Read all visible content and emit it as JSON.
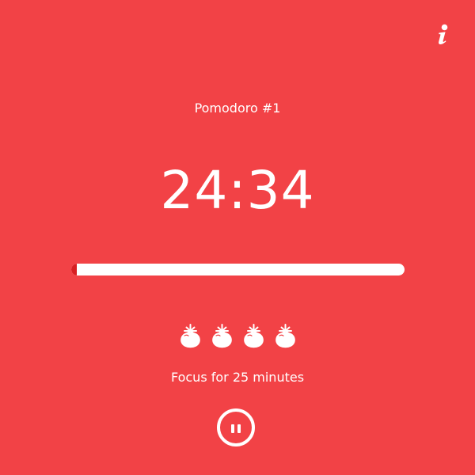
{
  "theme": {
    "background": "#f24246",
    "foreground": "#ffffff",
    "progress_fill": "#d81e22"
  },
  "header": {
    "info_icon": "info-icon"
  },
  "session": {
    "title": "Pomodoro #1"
  },
  "timer": {
    "display": "24:34",
    "progress_fraction": 0.016
  },
  "tomatoes": {
    "count": 4,
    "icon": "tomato-icon"
  },
  "status": {
    "message": "Focus for 25 minutes"
  },
  "controls": {
    "pause_icon": "pause-icon"
  }
}
